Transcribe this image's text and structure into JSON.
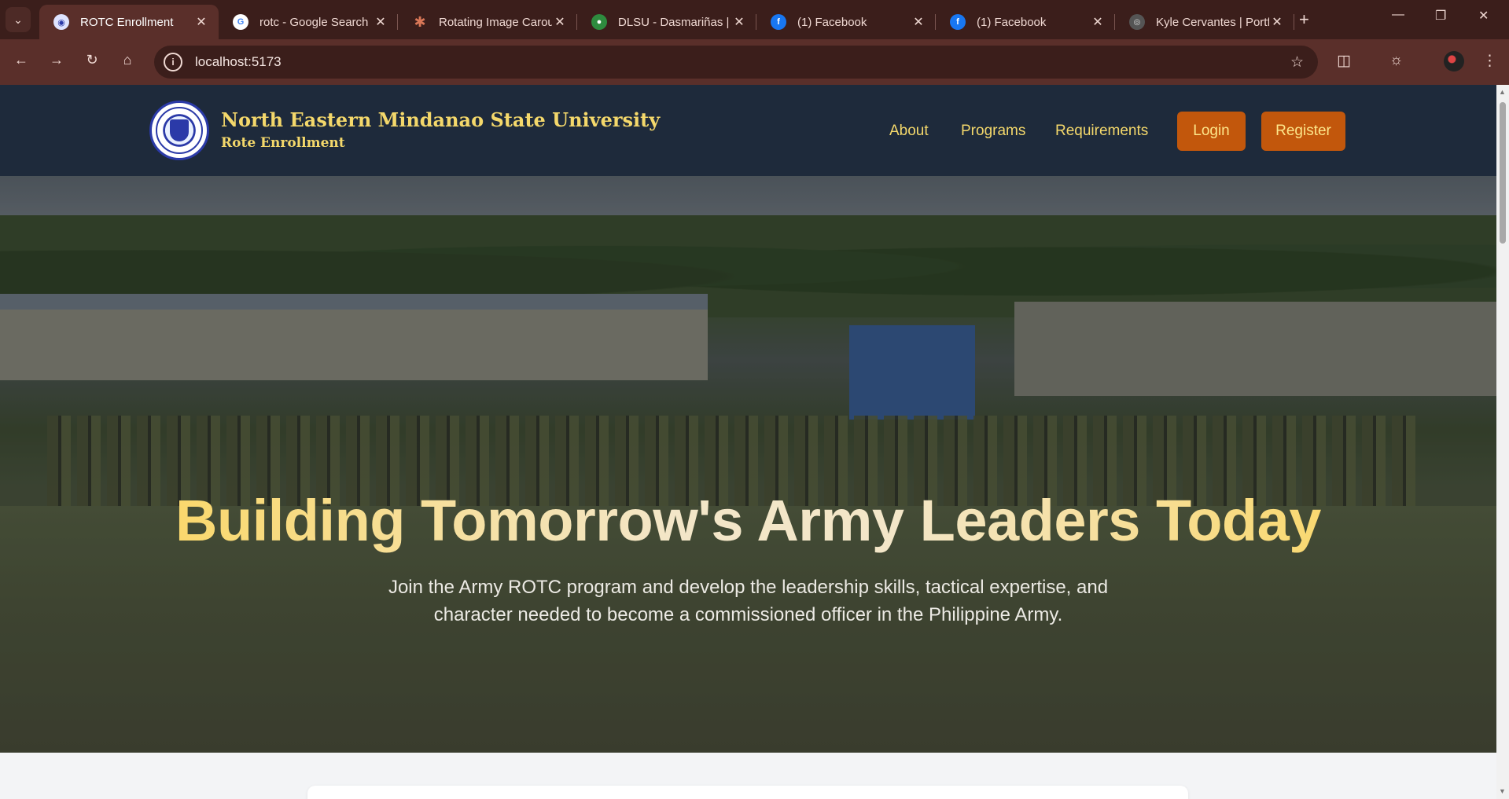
{
  "browser": {
    "tabs": [
      {
        "title": "ROTC Enrollment",
        "favicon": "shield-favicon",
        "active": true
      },
      {
        "title": "rotc - Google Search",
        "favicon": "google-favicon",
        "active": false
      },
      {
        "title": "Rotating Image Carou",
        "favicon": "claude-favicon",
        "active": false
      },
      {
        "title": "DLSU - Dasmariñas |",
        "favicon": "dlsu-favicon",
        "active": false
      },
      {
        "title": "(1) Facebook",
        "favicon": "facebook-favicon",
        "active": false
      },
      {
        "title": "(1) Facebook",
        "favicon": "facebook-favicon",
        "active": false
      },
      {
        "title": "Kyle Cervantes | Portf",
        "favicon": "portfolio-favicon",
        "active": false
      }
    ],
    "url": "localhost:5173",
    "colors": {
      "frame": "#3b1e1b",
      "toolbar": "#5a2f2a"
    }
  },
  "site": {
    "brand": {
      "name": "North Eastern Mindanao State University",
      "subtitle": "Rote Enrollment"
    },
    "nav": {
      "links": [
        "About",
        "Programs",
        "Requirements"
      ],
      "login_label": "Login",
      "register_label": "Register"
    },
    "hero": {
      "title": "Building Tomorrow's Army Leaders Today",
      "description": "Join the Army ROTC program and develop the leadership skills, tactical expertise, and character needed to become a commissioned officer in the Philippine Army."
    },
    "colors": {
      "nav_bg": "#1e2a3b",
      "accent_gold": "#f4d86b",
      "button_orange": "#c2570c",
      "page_bg": "#f3f4f6"
    }
  }
}
